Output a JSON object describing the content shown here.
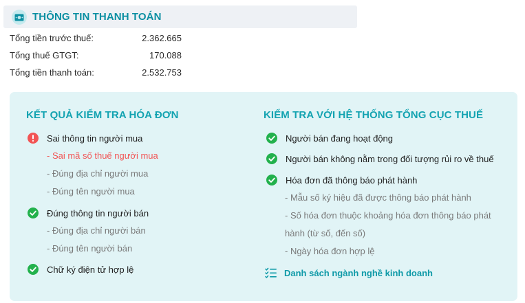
{
  "payment": {
    "title": "THÔNG TIN THANH TOÁN",
    "icon": "cash-icon",
    "rows": [
      {
        "label": "Tổng tiền trước thuế:",
        "value": "2.362.665"
      },
      {
        "label": "Tổng thuế GTGT:",
        "value": "170.088"
      },
      {
        "label": "Tổng tiền thanh toán:",
        "value": "2.532.753"
      }
    ]
  },
  "invoice_check": {
    "title": "KẾT QUẢ KIỂM TRA HÓA ĐƠN",
    "groups": [
      {
        "status": "error",
        "label": "Sai thông tin người mua",
        "details": [
          {
            "text": "- Sai mã số thuế người mua",
            "status": "error"
          },
          {
            "text": "- Đúng địa chỉ người mua",
            "status": "ok"
          },
          {
            "text": "- Đúng tên người mua",
            "status": "ok"
          }
        ]
      },
      {
        "status": "ok",
        "label": "Đúng thông tin người bán",
        "details": [
          {
            "text": "- Đúng địa chỉ người bán",
            "status": "ok"
          },
          {
            "text": "- Đúng tên người bán",
            "status": "ok"
          }
        ]
      },
      {
        "status": "ok",
        "label": "Chữ ký điện tử hợp lệ",
        "details": []
      }
    ]
  },
  "tax_system_check": {
    "title": "KIỂM TRA VỚI HỆ THỐNG TỔNG CỤC THUẾ",
    "items": [
      {
        "status": "ok",
        "label": "Người bán đang hoạt động"
      },
      {
        "status": "ok",
        "label": "Người bán không nằm trong đối tượng rủi ro về thuế"
      },
      {
        "status": "ok",
        "label": "Hóa đơn đã thông báo phát hành"
      }
    ],
    "details": [
      "- Mẫu số ký hiệu đã được thông báo phát hành",
      "- Số hóa đơn thuộc khoảng hóa đơn thông báo phát",
      "hành (từ số, đến số)",
      "- Ngày hóa đơn hợp lệ"
    ],
    "link_label": "Danh sách ngành nghề kinh doanh",
    "link_icon": "list-check-icon"
  },
  "colors": {
    "accent": "#13a3b1",
    "ok": "#22b14c",
    "error": "#f25454",
    "panel_bg": "#e1f4f6"
  }
}
